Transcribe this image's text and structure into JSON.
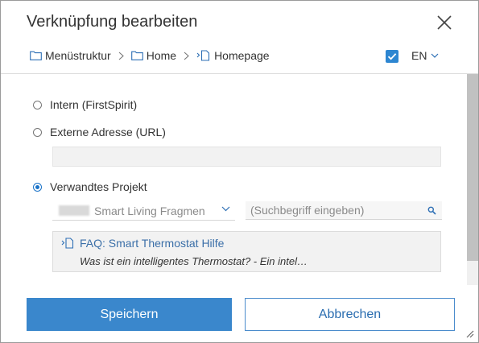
{
  "dialog": {
    "title": "Verknüpfung bearbeiten",
    "accent_color": "#3a87cc"
  },
  "breadcrumb": {
    "items": [
      {
        "label": "Menüstruktur",
        "icon": "folder-icon"
      },
      {
        "label": "Home",
        "icon": "folder-icon"
      },
      {
        "label": "Homepage",
        "icon": "page-link-icon"
      }
    ]
  },
  "language": {
    "checked": true,
    "selected": "EN"
  },
  "options": {
    "intern": {
      "label": "Intern (FirstSpirit)",
      "selected": false
    },
    "extern": {
      "label": "Externe Adresse (URL)",
      "selected": false,
      "url_value": ""
    },
    "related": {
      "label": "Verwandtes Projekt",
      "selected": true
    }
  },
  "project_select": {
    "selected": "Smart Living Fragmen"
  },
  "search": {
    "placeholder": "(Suchbegriff eingeben)",
    "value": ""
  },
  "result": {
    "title": "FAQ: Smart Thermostat Hilfe",
    "description": "Was ist ein intelligentes Thermostat? - Ein intel…"
  },
  "buttons": {
    "save": "Speichern",
    "cancel": "Abbrechen"
  }
}
